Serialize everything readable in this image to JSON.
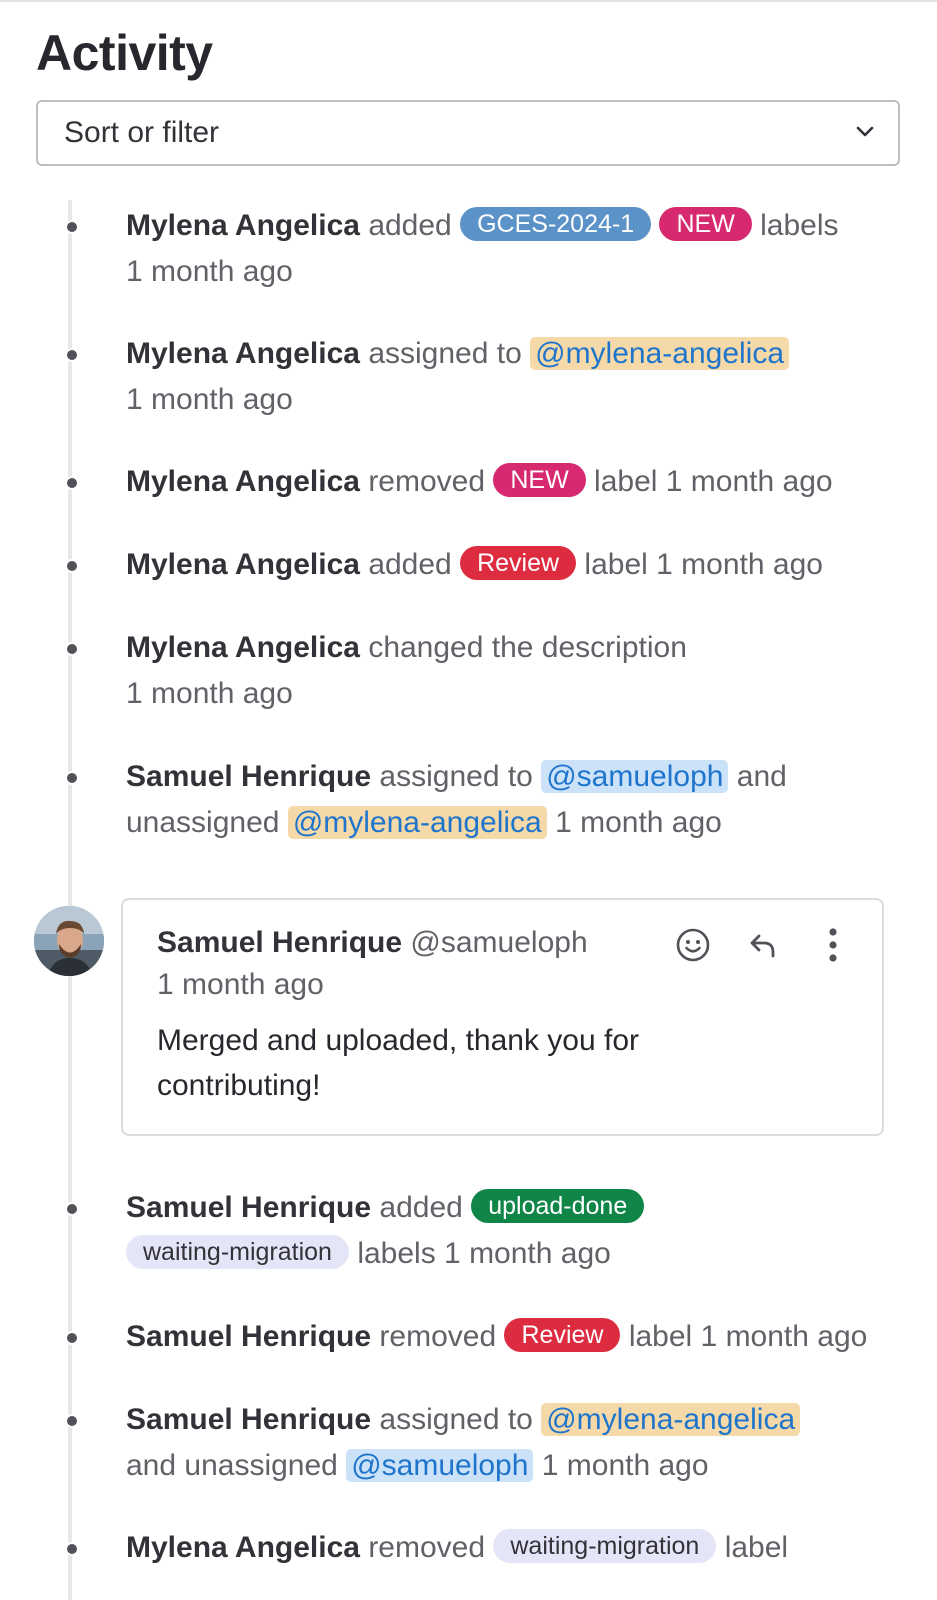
{
  "header": {
    "title": "Activity"
  },
  "sort": {
    "label": "Sort or filter"
  },
  "colors": {
    "label_gces": "#5b92c7",
    "label_new": "#d6296f",
    "label_review": "#dd2b3f",
    "label_upload_done": "#108548",
    "label_waiting_migration": "#e5e5f8",
    "mention_self": "#f5d9a8",
    "mention_other": "#cbe2f9"
  },
  "events": [
    {
      "author": "Mylena Angelica",
      "text1": "added",
      "label1": "GCES-2024-1",
      "label2": "NEW",
      "text2": "labels",
      "time": "1 month ago"
    },
    {
      "author": "Mylena Angelica",
      "text1": "assigned to",
      "mention1": "@mylena-angelica",
      "time": "1 month ago"
    },
    {
      "author": "Mylena Angelica",
      "text1": "removed",
      "label1": "NEW",
      "text2": "label",
      "time": "1 month ago"
    },
    {
      "author": "Mylena Angelica",
      "text1": "added",
      "label1": "Review",
      "text2": "label",
      "time": "1 month ago"
    },
    {
      "author": "Mylena Angelica",
      "text1": "changed the description",
      "time": "1 month ago"
    },
    {
      "author": "Samuel Henrique",
      "text1": "assigned to",
      "mention1": "@samueloph",
      "text2": "and",
      "text3": "unassigned",
      "mention2": "@mylena-angelica",
      "time": "1 month ago"
    },
    {
      "author": "Samuel Henrique",
      "text1": "added",
      "label1": "upload-done",
      "label2": "waiting-migration",
      "text2": "labels",
      "time": "1 month ago"
    },
    {
      "author": "Samuel Henrique",
      "text1": "removed",
      "label1": "Review",
      "text2": "label",
      "time": "1 month ago"
    },
    {
      "author": "Samuel Henrique",
      "text1": "assigned to",
      "mention1": "@mylena-angelica",
      "text2": "and unassigned",
      "mention2": "@samueloph",
      "time": "1 month ago"
    },
    {
      "author": "Mylena Angelica",
      "text1": "removed",
      "label1": "waiting-migration",
      "text2": "label"
    }
  ],
  "comment": {
    "author": "Samuel Henrique",
    "username": "@samueloph",
    "time": "1 month ago",
    "body": "Merged and uploaded, thank you for contributing!",
    "actions": [
      "smiley-icon",
      "reply-icon",
      "more-options-icon"
    ]
  }
}
